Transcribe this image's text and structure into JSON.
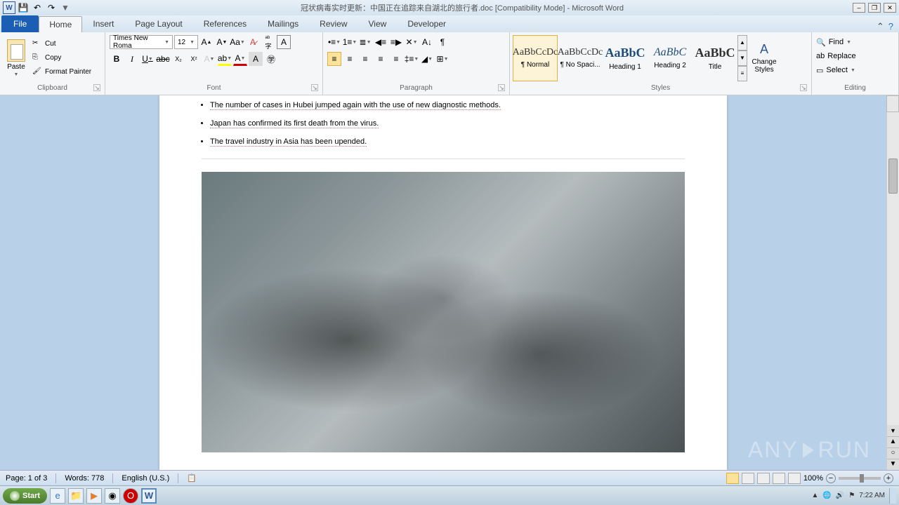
{
  "titlebar": {
    "title": "冠状病毒实时更新：中国正在追踪来自湖北的旅行者.doc [Compatibility Mode]  -  Microsoft Word"
  },
  "tabs": {
    "file": "File",
    "home": "Home",
    "insert": "Insert",
    "pagelayout": "Page Layout",
    "references": "References",
    "mailings": "Mailings",
    "review": "Review",
    "view": "View",
    "developer": "Developer"
  },
  "ribbon": {
    "clipboard": {
      "label": "Clipboard",
      "paste": "Paste",
      "cut": "Cut",
      "copy": "Copy",
      "format_painter": "Format Painter"
    },
    "font": {
      "label": "Font",
      "name": "Times New Roma",
      "size": "12"
    },
    "paragraph": {
      "label": "Paragraph"
    },
    "styles": {
      "label": "Styles",
      "items": [
        {
          "preview": "AaBbCcDc",
          "name": "¶ Normal"
        },
        {
          "preview": "AaBbCcDc",
          "name": "¶ No Spaci..."
        },
        {
          "preview": "AaBbC",
          "name": "Heading 1"
        },
        {
          "preview": "AaBbC",
          "name": "Heading 2"
        },
        {
          "preview": "AaBbC",
          "name": "Title"
        }
      ],
      "change": "Change Styles"
    },
    "editing": {
      "label": "Editing",
      "find": "Find",
      "replace": "Replace",
      "select": "Select"
    }
  },
  "document": {
    "bullets": [
      "The number of cases in Hubei jumped again with the use of new diagnostic methods.",
      "Japan has confirmed its first death from the virus.",
      "The travel industry in Asia has been upended."
    ]
  },
  "statusbar": {
    "page": "Page: 1 of 3",
    "words": "Words: 778",
    "lang": "English (U.S.)",
    "zoom": "100%"
  },
  "taskbar": {
    "start": "Start",
    "time": "7:22 AM"
  },
  "watermark": {
    "a": "ANY",
    "b": "RUN"
  }
}
